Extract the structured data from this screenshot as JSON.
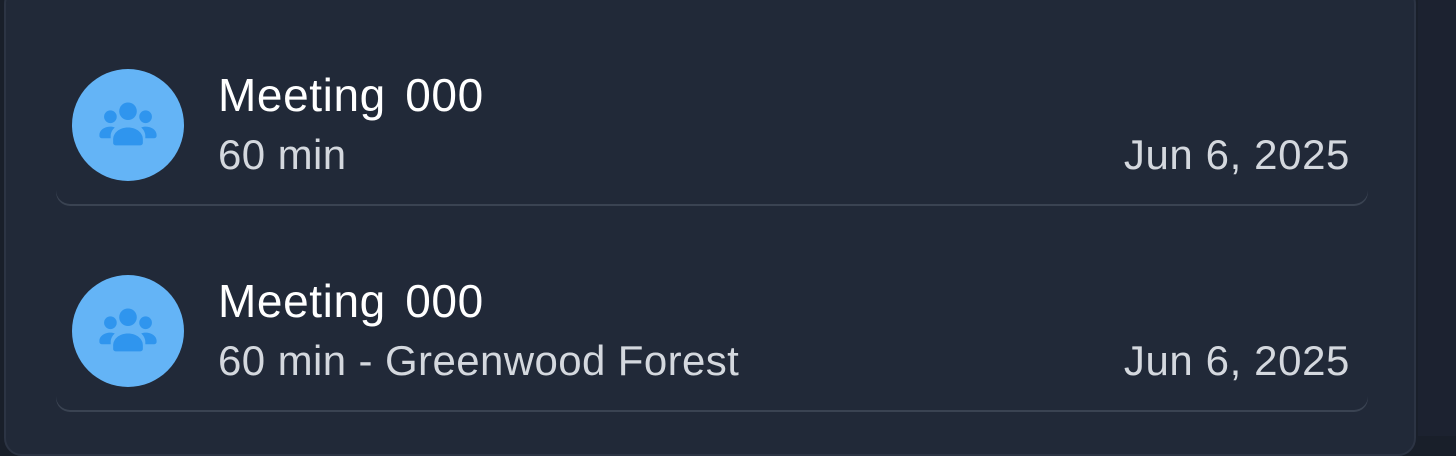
{
  "meetings": [
    {
      "title": "Meeting 000",
      "subtitle": "60 min",
      "date": "Jun 6, 2025",
      "icon": "group-icon"
    },
    {
      "title": "Meeting 000",
      "subtitle": "60 min - Greenwood Forest",
      "date": "Jun 6, 2025",
      "icon": "group-icon"
    }
  ],
  "colors": {
    "background": "#212938",
    "avatar": "#64b4f6",
    "avatar_icon": "#2f95ee",
    "title_text": "#ffffff",
    "secondary_text": "#d4d8de"
  }
}
